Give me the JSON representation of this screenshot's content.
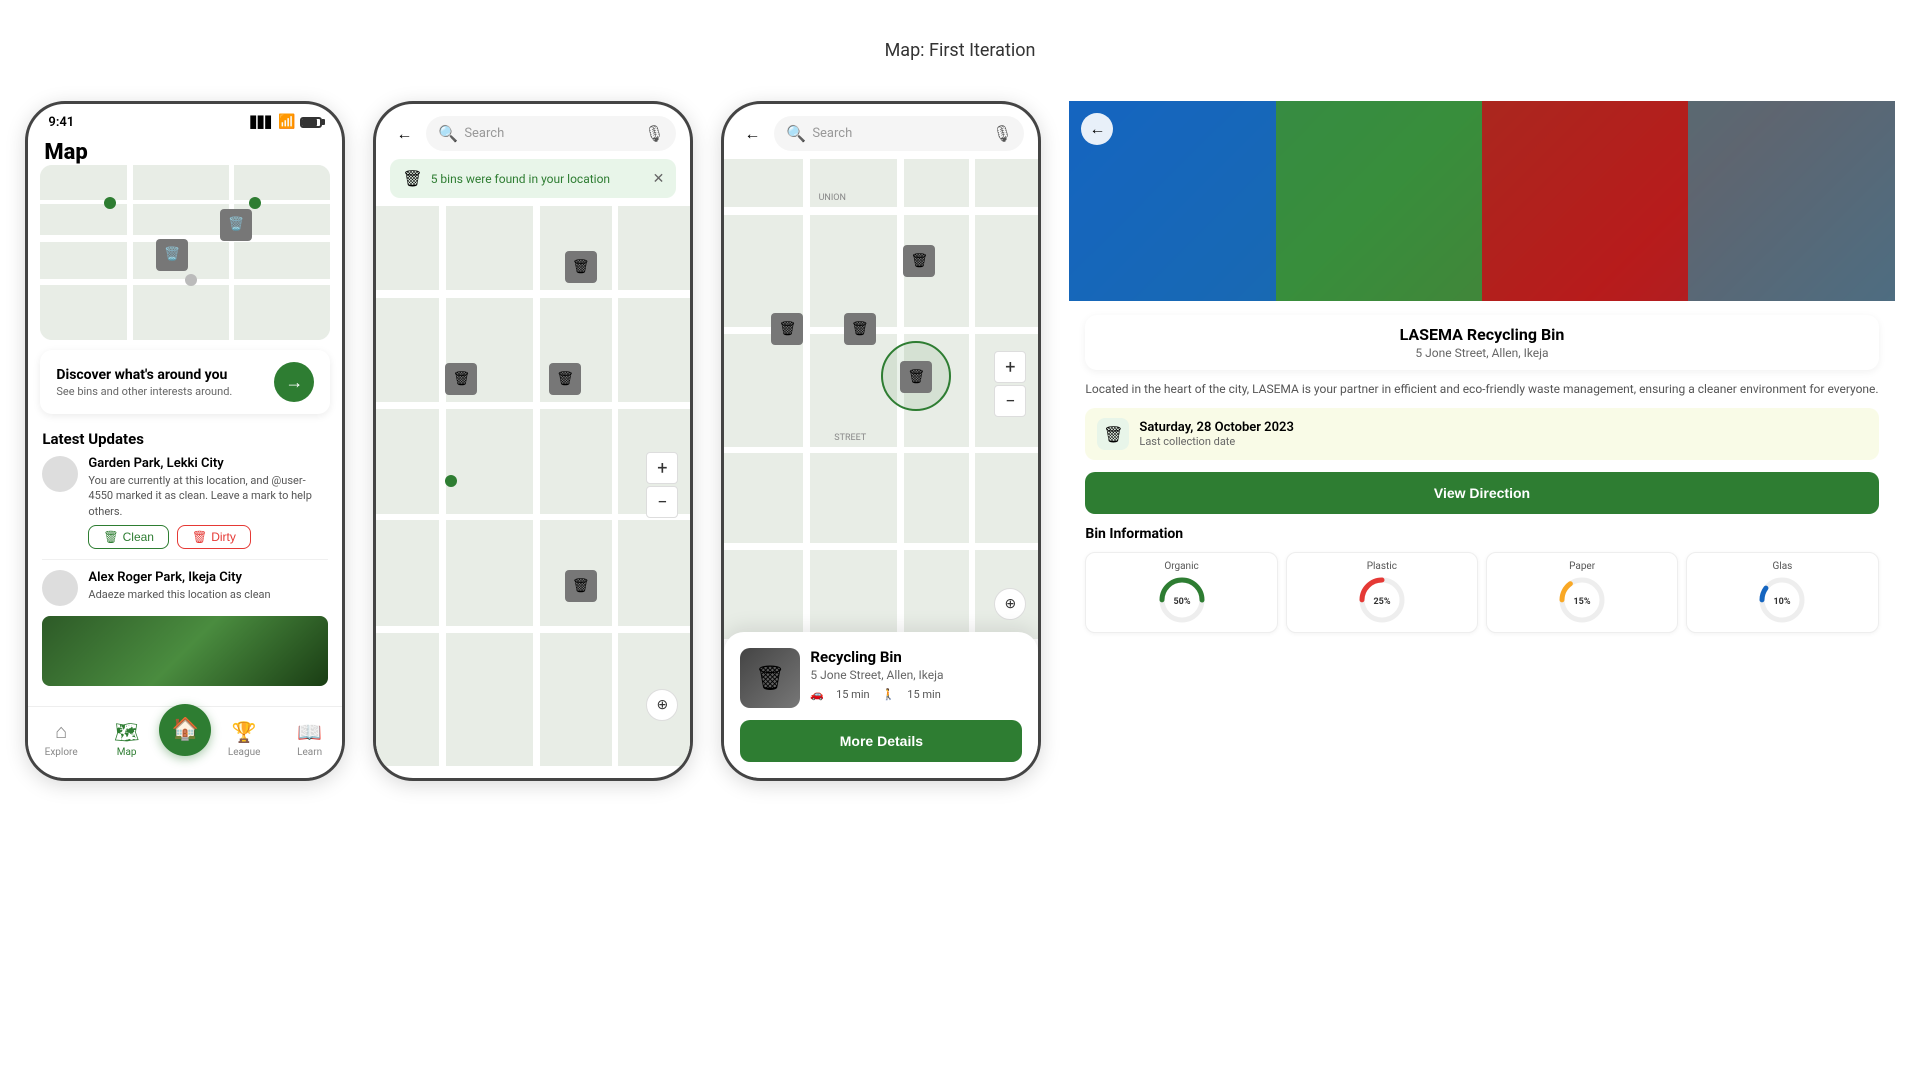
{
  "page": {
    "title": "Map: First Iteration"
  },
  "phone1": {
    "status_time": "9:41",
    "screen_title": "Map",
    "discover": {
      "title": "Discover what's around you",
      "subtitle": "See bins and other interests around."
    },
    "updates_title": "Latest Updates",
    "update1": {
      "name": "Garden Park, Lekki City",
      "desc": "You are currently at this location, and @user-4550 marked it as clean. Leave a mark to help others.",
      "clean_btn": "Clean",
      "dirty_btn": "Dirty"
    },
    "update2": {
      "name": "Alex Roger Park, Ikeja City",
      "desc": "Adaeze marked this location as clean"
    },
    "nav": {
      "explore": "Explore",
      "map": "Map",
      "league": "League",
      "learn": "Learn"
    }
  },
  "phone2": {
    "search_placeholder": "Search",
    "notification": "5 bins were found in your location"
  },
  "phone3": {
    "search_placeholder": "Search",
    "bin": {
      "name": "Recycling Bin",
      "address": "5 Jone Street, Allen, Ikeja",
      "drive_time": "15 min",
      "walk_time": "15 min",
      "more_details_btn": "More Details"
    }
  },
  "phone4": {
    "bin_name": "LASEMA Recycling Bin",
    "bin_address": "5 Jone Street, Allen, Ikeja",
    "description": "Located in the heart of the city, LASEMA is your partner in efficient and eco-friendly waste management, ensuring a cleaner environment for everyone.",
    "date_label": "Saturday, 28 October 2023",
    "date_sub": "Last collection date",
    "view_dir_btn": "View Direction",
    "bin_info_title": "Bin Information",
    "bins": [
      {
        "label": "Organic",
        "pct": 50,
        "color": "#2e7d32"
      },
      {
        "label": "Plastic",
        "pct": 25,
        "color": "#e53935"
      },
      {
        "label": "Paper",
        "pct": 15,
        "color": "#f9a825"
      },
      {
        "label": "Glas",
        "pct": 10,
        "color": "#1565c0"
      }
    ]
  }
}
